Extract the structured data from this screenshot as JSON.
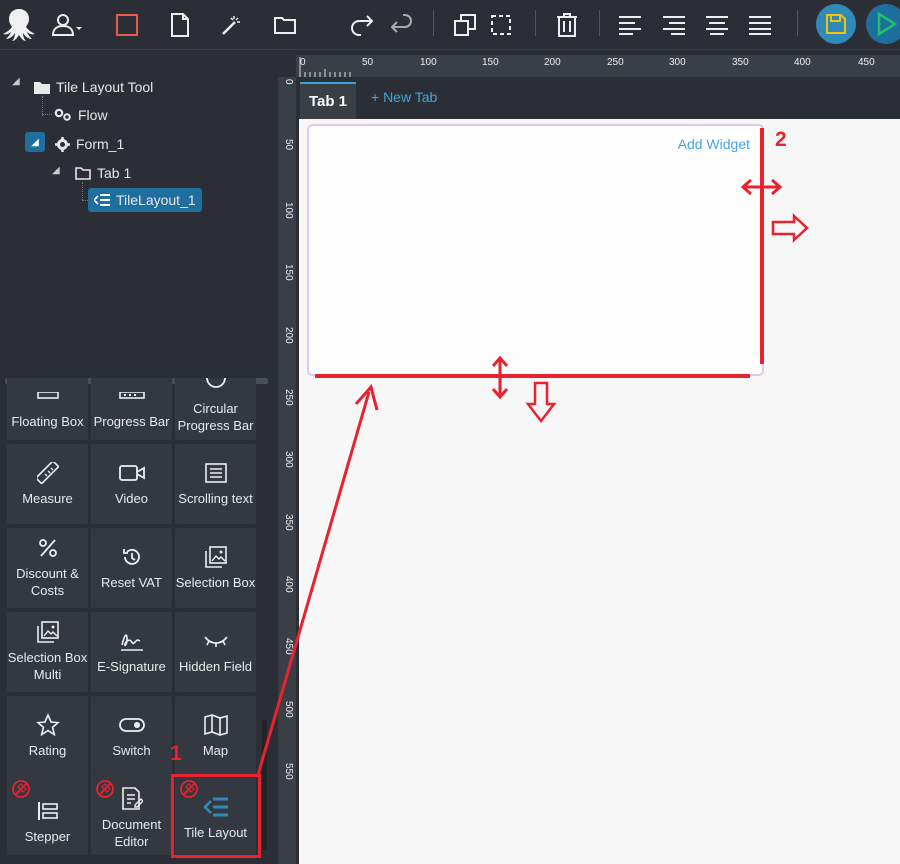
{
  "toolbar": {
    "icons": [
      "octopus-logo",
      "user-icon",
      "square-icon",
      "file-icon",
      "magic-wand-icon",
      "folder-icon",
      "redo-icon",
      "undo-icon",
      "copy-icon",
      "select-region-icon",
      "trash-icon",
      "align-left-icon",
      "align-right-icon",
      "align-center-icon",
      "align-justify-icon",
      "save-icon",
      "play-icon"
    ],
    "colors": {
      "square": "#e65b4b",
      "save_bg": "#2f8ab8",
      "save_fg": "#f4c20d",
      "play_bg": "#1f6f9e",
      "play_fg": "#20c36a"
    }
  },
  "tree": {
    "root": "Tile Layout Tool",
    "flow": "Flow",
    "form": "Form_1",
    "tab": "Tab 1",
    "tile": "TileLayout_1"
  },
  "widgets": {
    "row0": [
      "Floating Box",
      "Progress Bar",
      "Circular Progress Bar"
    ],
    "row1": [
      "Measure",
      "Video",
      "Scrolling text"
    ],
    "row2": [
      "Discount & Costs",
      "Reset VAT",
      "Selection Box"
    ],
    "row3": [
      "Selection Box Multi",
      "E-Signature",
      "Hidden Field"
    ],
    "row4": [
      "Rating",
      "Switch",
      "Map"
    ],
    "row5": [
      "Stepper",
      "Document Editor",
      "Tile Layout"
    ]
  },
  "ruler": {
    "top": [
      "0",
      "50",
      "100",
      "150",
      "200",
      "250",
      "300",
      "350",
      "400",
      "450"
    ],
    "left": [
      "0",
      "50",
      "100",
      "150",
      "200",
      "250",
      "300",
      "350",
      "400",
      "450",
      "500",
      "550"
    ]
  },
  "tabs": {
    "active": "Tab 1",
    "new_tab": "+ New Tab"
  },
  "canvas": {
    "add_widget": "Add Widget"
  },
  "annotations": {
    "step1": "1",
    "step2": "2",
    "color": "#e8222e"
  }
}
